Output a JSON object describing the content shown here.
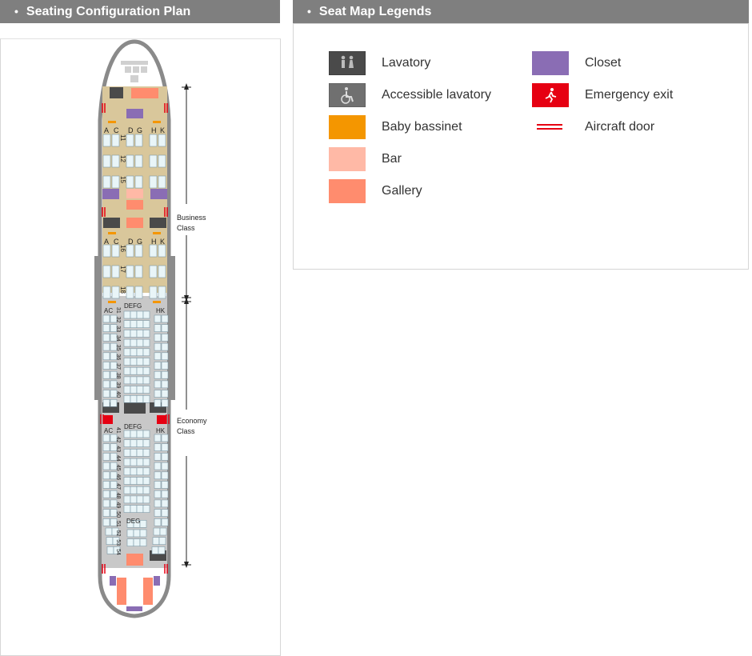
{
  "header": {
    "seating_title": "Seating Configuration Plan",
    "legend_title": "Seat Map Legends"
  },
  "legends": [
    {
      "key": "lavatory",
      "label": "Lavatory",
      "color": "#4a4a4a",
      "icon": "lavatory-icon"
    },
    {
      "key": "accessible",
      "label": "Accessible lavatory",
      "color": "#707070",
      "icon": "wheelchair-icon"
    },
    {
      "key": "bassinet",
      "label": "Baby bassinet",
      "color": "#f49600",
      "icon": ""
    },
    {
      "key": "bar",
      "label": "Bar",
      "color": "#ffb9a6",
      "icon": ""
    },
    {
      "key": "gallery",
      "label": "Gallery",
      "color": "#ff8c6e",
      "icon": ""
    },
    {
      "key": "closet",
      "label": "Closet",
      "color": "#8a6db4",
      "icon": ""
    },
    {
      "key": "exit",
      "label": "Emergency exit",
      "color": "#e60012",
      "icon": "emergency-exit-icon"
    },
    {
      "key": "door",
      "label": "Aircraft door",
      "color": "#e60012",
      "icon": "aircraft-door-icon"
    }
  ],
  "seatmap": {
    "business": {
      "label_lines": [
        "Business",
        "Class"
      ],
      "letters_left": [
        "A",
        "C"
      ],
      "letters_center": [
        "D",
        "G"
      ],
      "letters_right": [
        "H",
        "K"
      ],
      "rows_front": [
        "11",
        "12",
        "15"
      ],
      "rows_rear": [
        "16",
        "17",
        "18"
      ]
    },
    "economy": {
      "label_lines": [
        "Economy",
        "Class"
      ],
      "letters_left": "AC",
      "letters_center": "DEFG",
      "letters_right": "HK",
      "letters_rear_center": "DEG",
      "rows_front": [
        "31",
        "32",
        "33",
        "34",
        "35",
        "36",
        "37",
        "38",
        "39",
        "40"
      ],
      "rows_rear": [
        "41",
        "42",
        "43",
        "44",
        "45",
        "46",
        "47",
        "48",
        "49",
        "50",
        "51",
        "52",
        "53",
        "54"
      ]
    },
    "colors": {
      "business_floor": "#d9c79b",
      "economy_floor": "#c8c8c8",
      "seat": "#e9f5f8",
      "seat_border": "#7d98a6"
    }
  }
}
